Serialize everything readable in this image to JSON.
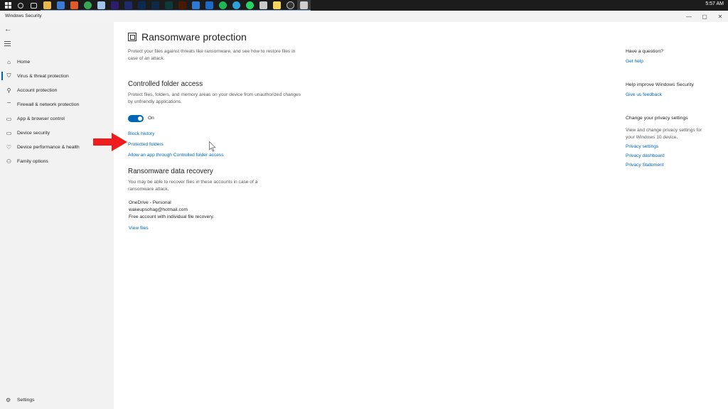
{
  "taskbar": {
    "time": "5:57 AM",
    "icons": [
      {
        "name": "windows-start-icon"
      },
      {
        "name": "search-icon",
        "color": "#dddddd"
      },
      {
        "name": "task-view-icon",
        "color": "#dddddd"
      },
      {
        "name": "file-explorer-icon",
        "color": "#e8b84a"
      },
      {
        "name": "store-icon",
        "color": "#3a7bd5"
      },
      {
        "name": "app-icon",
        "color": "#e05a2a"
      },
      {
        "name": "chrome-icon",
        "color": "#34a853"
      },
      {
        "name": "notepad-icon",
        "color": "#9fc5e8"
      },
      {
        "name": "premiere-icon",
        "color": "#2d1d6e"
      },
      {
        "name": "media-encoder-icon",
        "color": "#1d2a6e"
      },
      {
        "name": "photoshop-icon",
        "color": "#0a2a4f"
      },
      {
        "name": "lightroom-icon",
        "color": "#0d2b46"
      },
      {
        "name": "audition-icon",
        "color": "#0e3b3a"
      },
      {
        "name": "illustrator-icon",
        "color": "#4a1a00"
      },
      {
        "name": "photos-icon",
        "color": "#2d7ad6"
      },
      {
        "name": "mail-icon",
        "color": "#1b6ac9"
      },
      {
        "name": "spotify-icon",
        "color": "#1db954"
      },
      {
        "name": "telegram-icon",
        "color": "#2aa3dc"
      },
      {
        "name": "whatsapp-icon",
        "color": "#25d366"
      },
      {
        "name": "image-viewer-icon",
        "color": "#c9c9c9"
      },
      {
        "name": "sticky-notes-icon",
        "color": "#f6d55c"
      },
      {
        "name": "obs-icon",
        "color": "#333333"
      },
      {
        "name": "windows-security-icon",
        "color": "#cfcfcf"
      }
    ]
  },
  "window": {
    "title": "Windows Security",
    "minimize_glyph": "—",
    "maximize_glyph": "▢",
    "close_glyph": "✕"
  },
  "sidebar": {
    "back_glyph": "←",
    "items": [
      {
        "label": "Home",
        "icon": "home-icon",
        "glyph": "⌂"
      },
      {
        "label": "Virus & threat protection",
        "icon": "shield-icon",
        "glyph": "⛉"
      },
      {
        "label": "Account protection",
        "icon": "person-icon",
        "glyph": "⚲"
      },
      {
        "label": "Firewall & network protection",
        "icon": "network-icon",
        "glyph": "⌔"
      },
      {
        "label": "App & browser control",
        "icon": "browser-icon",
        "glyph": "▭"
      },
      {
        "label": "Device security",
        "icon": "laptop-icon",
        "glyph": "▭"
      },
      {
        "label": "Device performance & health",
        "icon": "heart-icon",
        "glyph": "♡"
      },
      {
        "label": "Family options",
        "icon": "family-icon",
        "glyph": "⚇"
      }
    ],
    "settings_label": "Settings",
    "settings_glyph": "⚙",
    "accent": "#0063b1"
  },
  "main": {
    "title": "Ransomware protection",
    "intro": "Protect your files against threats like ransomware, and see how to restore files in case of an attack.",
    "cfa_heading": "Controlled folder access",
    "cfa_desc": "Protect files, folders, and memory areas on your device from unauthorized changes by unfriendly applications.",
    "toggle_state": "On",
    "links": {
      "block_history": "Block history",
      "protected_folders": "Protected folders",
      "allow_app": "Allow an app through Controlled folder access"
    },
    "recovery_heading": "Ransomware data recovery",
    "recovery_desc": "You may be able to recover files in these accounts in case of a ransomware attack.",
    "account": {
      "provider": "OneDrive - Personal",
      "email": "wakeupsohag@hotmail.com",
      "plan": "Free account with individual file recovery."
    },
    "view_files": "View files",
    "link_color": "#0067b8"
  },
  "right": {
    "question_heading": "Have a question?",
    "get_help": "Get help",
    "improve_heading": "Help improve Windows Security",
    "give_feedback": "Give us feedback",
    "privacy_heading": "Change your privacy settings",
    "privacy_desc": "View and change privacy settings for your Windows 10 device.",
    "privacy_settings": "Privacy settings",
    "privacy_dashboard": "Privacy dashboard",
    "privacy_statement": "Privacy Statement"
  },
  "annotation": {
    "arrow_color": "#ee1c1c"
  }
}
